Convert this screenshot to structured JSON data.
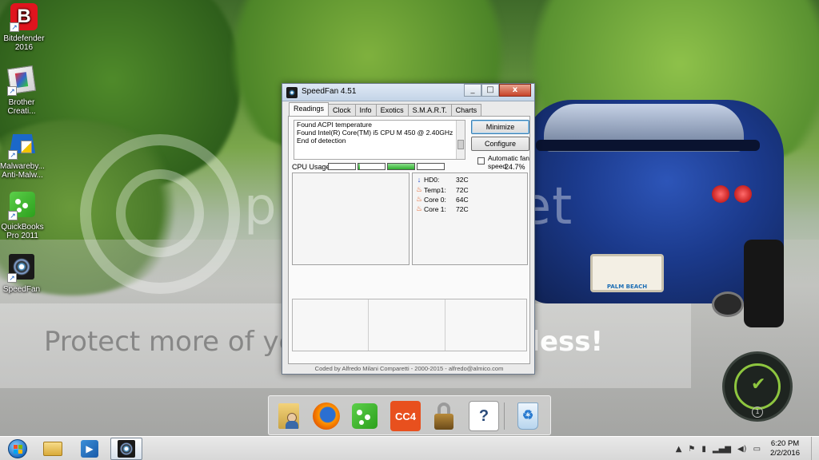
{
  "desktop": {
    "icons": [
      {
        "label": "Bitdefender 2016",
        "icon": "bitdefender-icon",
        "color": "#e0141e"
      },
      {
        "label": "Brother Creati...",
        "icon": "brother-creativecenter-icon",
        "color": "#3c78c8"
      },
      {
        "label": "Malwareby... Anti-Malw...",
        "icon": "malwarebytes-icon",
        "color": "#1b68c9"
      },
      {
        "label": "QuickBooks Pro 2011",
        "icon": "quickbooks-icon",
        "color": "#2ca01c"
      },
      {
        "label": "SpeedFan",
        "icon": "speedfan-icon",
        "color": "#1a1a1a"
      }
    ]
  },
  "watermark": {
    "logo_text": "photobucket",
    "band_text_prefix": "Protect more of your memories ",
    "band_text_bold": "for less!"
  },
  "background": {
    "plate_text": "PALM BEACH"
  },
  "window": {
    "title": "SpeedFan 4.51",
    "controls": {
      "minimize": "_",
      "maximize": "□",
      "close": "x"
    },
    "tabs": [
      "Readings",
      "Clock",
      "Info",
      "Exotics",
      "S.M.A.R.T.",
      "Charts"
    ],
    "active_tab": "Readings",
    "log_lines": [
      "Found ACPI temperature",
      "Found Intel(R) Core(TM) i5 CPU M 450 @ 2.40GHz",
      "End of detection"
    ],
    "buttons": {
      "minimize": "Minimize",
      "configure": "Configure"
    },
    "auto_fan": {
      "label": "Automatic fan speed",
      "checked": false
    },
    "cpu": {
      "label": "CPU Usage",
      "bar_levels": [
        0.0,
        0.05,
        1.0,
        0.0
      ],
      "value": "24.7%"
    },
    "temps": [
      {
        "name": "HD0:",
        "value": "32C",
        "icon": "arrow-down-icon"
      },
      {
        "name": "Temp1:",
        "value": "72C",
        "icon": "flame-icon"
      },
      {
        "name": "Core 0:",
        "value": "64C",
        "icon": "flame-icon"
      },
      {
        "name": "Core 1:",
        "value": "72C",
        "icon": "flame-icon"
      }
    ],
    "footer": "Coded by Alfredo Milani Comparetti - 2000-2015 - alfredo@almico.com"
  },
  "dock": {
    "items": [
      {
        "name": "user-folder-icon",
        "color": "#c9a445",
        "label": ""
      },
      {
        "name": "firefox-icon",
        "color": "#e66000",
        "label": ""
      },
      {
        "name": "quickbooks-dock-icon",
        "color": "#2ca01c",
        "label": ""
      },
      {
        "name": "cc4-icon",
        "color": "#e8501e",
        "label": "CC4"
      },
      {
        "name": "lock-icon",
        "color": "#8a6a2a",
        "label": ""
      },
      {
        "name": "help-icon",
        "color": "#ffffff",
        "label": "?"
      },
      {
        "name": "recycle-bin-icon",
        "color": "#cfe3f5",
        "label": ""
      }
    ]
  },
  "widget": {
    "badge": "1"
  },
  "taskbar": {
    "pinned": [
      "explorer-icon",
      "media-player-icon",
      "speedfan-taskbar-icon"
    ],
    "tray_icons": [
      "show-hidden-icons",
      "flag-icon",
      "battery-icon",
      "network-icon",
      "volume-icon",
      "action-icon"
    ],
    "time": "6:20 PM",
    "date": "2/2/2016"
  }
}
